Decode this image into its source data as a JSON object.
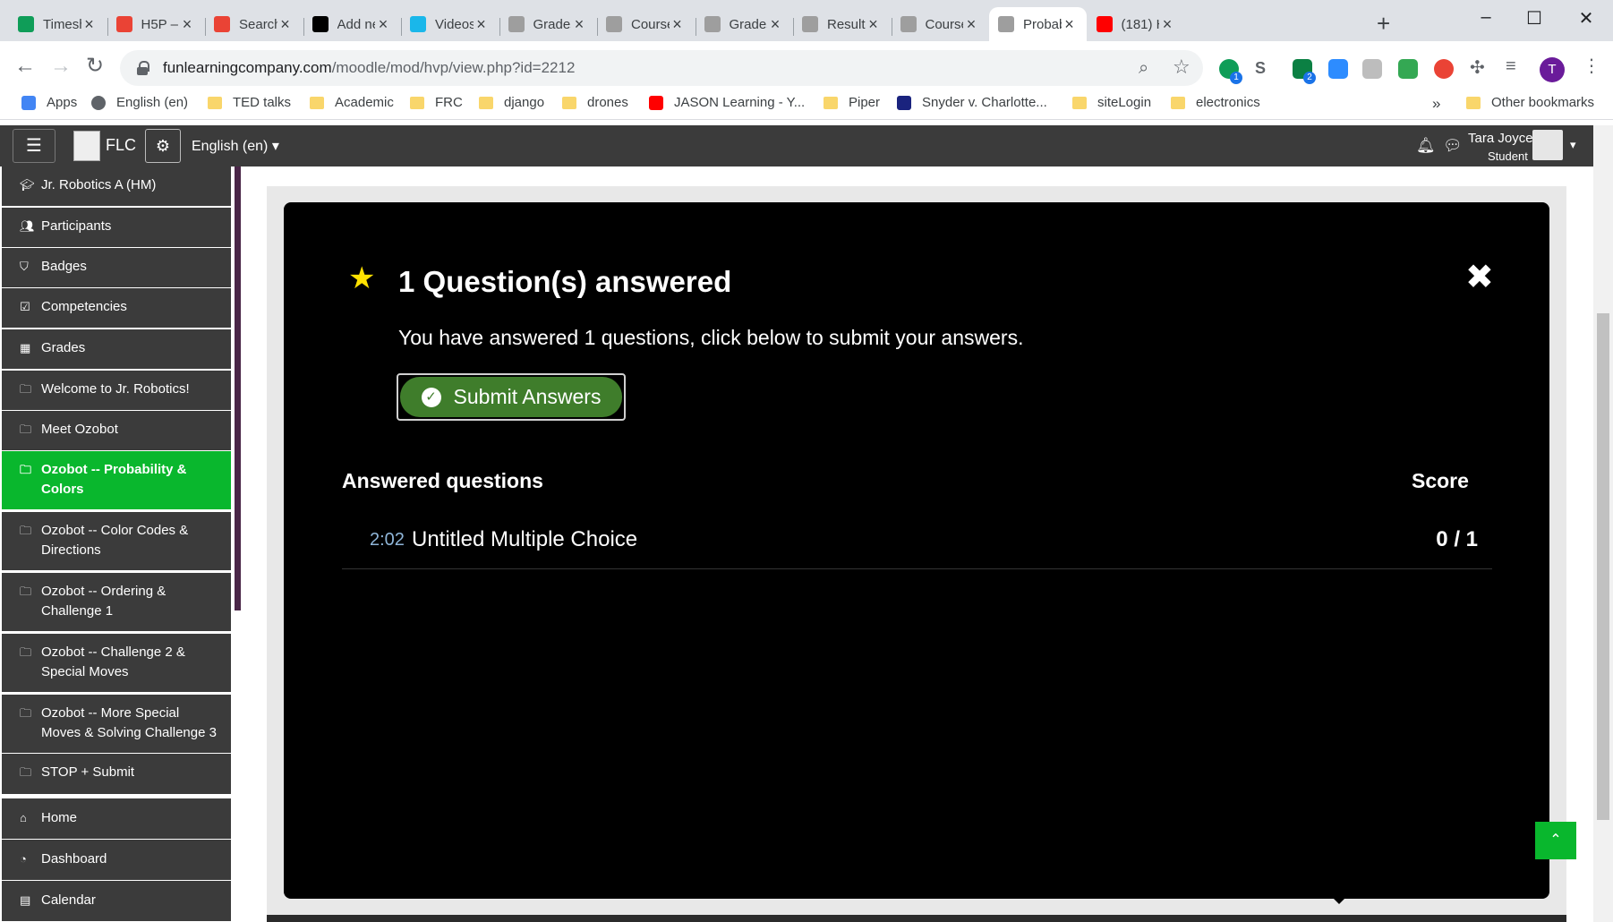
{
  "browser": {
    "tabs": [
      {
        "title": "Timesh",
        "favicon": "sheets-icon",
        "color": "#0f9d58"
      },
      {
        "title": "H5P – ",
        "favicon": "gmail-icon",
        "color": "#ea4335"
      },
      {
        "title": "Search",
        "favicon": "gmail-icon",
        "color": "#ea4335"
      },
      {
        "title": "Add ne",
        "favicon": "h5p-icon",
        "color": "#000000"
      },
      {
        "title": "Videos",
        "favicon": "vimeo-icon",
        "color": "#1ab7ea"
      },
      {
        "title": "Grades",
        "favicon": "moodle-icon",
        "color": "#9e9e9e"
      },
      {
        "title": "Course",
        "favicon": "moodle-icon",
        "color": "#9e9e9e"
      },
      {
        "title": "Grades",
        "favicon": "moodle-icon",
        "color": "#9e9e9e"
      },
      {
        "title": "Results",
        "favicon": "moodle-icon",
        "color": "#9e9e9e"
      },
      {
        "title": "Course",
        "favicon": "moodle-icon",
        "color": "#9e9e9e"
      },
      {
        "title": "Probab",
        "favicon": "moodle-icon",
        "color": "#9e9e9e",
        "active": true
      },
      {
        "title": "(181) H",
        "favicon": "youtube-icon",
        "color": "#ff0000"
      }
    ],
    "url_host": "funlearningcompany.com",
    "url_path": "/moodle/mod/hvp/view.php?id=2212",
    "extension_badges": [
      "1",
      "2"
    ],
    "profile_initial": "T",
    "bookmarks": [
      {
        "label": "Apps",
        "icon": "apps-icon"
      },
      {
        "label": "English (en)",
        "icon": "globe-icon"
      },
      {
        "label": "TED talks",
        "icon": "folder-icon"
      },
      {
        "label": "Academic",
        "icon": "folder-icon"
      },
      {
        "label": "FRC",
        "icon": "folder-icon"
      },
      {
        "label": "django",
        "icon": "folder-icon"
      },
      {
        "label": "drones",
        "icon": "folder-icon"
      },
      {
        "label": "JASON Learning - Y...",
        "icon": "youtube-icon"
      },
      {
        "label": "Piper",
        "icon": "folder-icon"
      },
      {
        "label": "Snyder v. Charlotte...",
        "icon": "j-icon"
      },
      {
        "label": "siteLogin",
        "icon": "folder-icon"
      },
      {
        "label": "electronics",
        "icon": "folder-icon"
      }
    ],
    "bookmarks_overflow": "»",
    "other_bookmarks": "Other bookmarks"
  },
  "moodle_nav": {
    "site_name": "FLC",
    "language": "English (en)",
    "user_name": "Tara Joyce",
    "user_role": "Student"
  },
  "drawer": {
    "items": [
      {
        "label": "Jr. Robotics A (HM)",
        "icon": "graduation-cap-icon"
      },
      {
        "label": "Participants",
        "icon": "users-icon"
      },
      {
        "label": "Badges",
        "icon": "shield-icon"
      },
      {
        "label": "Competencies",
        "icon": "checkbox-icon"
      },
      {
        "label": "Grades",
        "icon": "table-icon"
      },
      {
        "label": "Welcome to Jr. Robotics!",
        "icon": "folder-icon"
      },
      {
        "label": "Meet Ozobot",
        "icon": "folder-icon"
      },
      {
        "label": "Ozobot -- Probability & Colors",
        "icon": "folder-icon",
        "active": true
      },
      {
        "label": "Ozobot -- Color Codes & Directions",
        "icon": "folder-icon"
      },
      {
        "label": "Ozobot -- Ordering & Challenge 1",
        "icon": "folder-icon"
      },
      {
        "label": "Ozobot -- Challenge 2 & Special Moves",
        "icon": "folder-icon"
      },
      {
        "label": "Ozobot -- More Special Moves & Solving Challenge 3",
        "icon": "folder-icon"
      },
      {
        "label": "STOP + Submit",
        "icon": "folder-icon"
      },
      {
        "label": "Home",
        "icon": "home-icon"
      },
      {
        "label": "Dashboard",
        "icon": "dashboard-icon"
      },
      {
        "label": "Calendar",
        "icon": "calendar-icon"
      }
    ]
  },
  "summary": {
    "title": "1 Question(s) answered",
    "text": "You have answered 1 questions, click below to submit your answers.",
    "submit_label": "Submit Answers",
    "answered_header": "Answered questions",
    "score_header": "Score",
    "questions": [
      {
        "time": "2:02",
        "title": "Untitled Multiple Choice",
        "score": "0 / 1"
      }
    ]
  },
  "colors": {
    "accent_green": "#09b72d",
    "submit_green": "#3f7d2b",
    "nav_dark": "#3b3b3b",
    "h5p_bg": "#000000",
    "star_yellow": "#ffe100"
  }
}
